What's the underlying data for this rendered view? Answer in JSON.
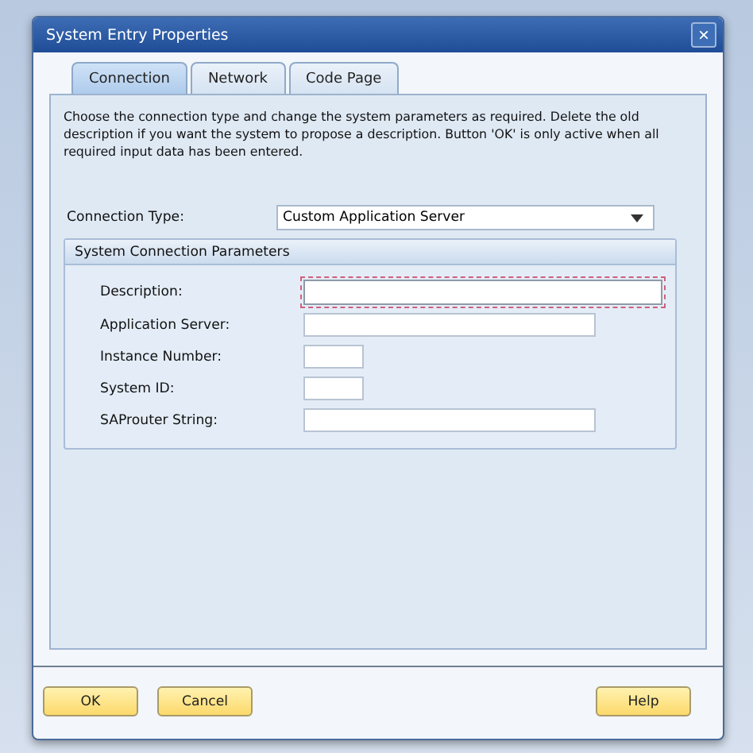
{
  "window": {
    "title": "System Entry Properties",
    "close": "×"
  },
  "tabs": [
    {
      "label": "Connection",
      "selected": true
    },
    {
      "label": "Network",
      "selected": false
    },
    {
      "label": "Code Page",
      "selected": false
    }
  ],
  "intro": "Choose the connection type and change the system parameters as required. Delete the old description if you want the system to propose a description. Button 'OK' is only active when all required input data has been entered.",
  "connection_type": {
    "label": "Connection Type:",
    "value": "Custom Application Server"
  },
  "group": {
    "title": "System Connection Parameters",
    "fields": [
      {
        "label": "Description:",
        "focused": true
      },
      {
        "label": "Application Server:",
        "focused": false
      },
      {
        "label": "Instance Number:",
        "focused": false
      },
      {
        "label": "System ID:",
        "focused": false
      },
      {
        "label": "SAProuter String:",
        "focused": false
      }
    ]
  },
  "buttons": [
    "OK",
    "Cancel",
    "Help"
  ]
}
